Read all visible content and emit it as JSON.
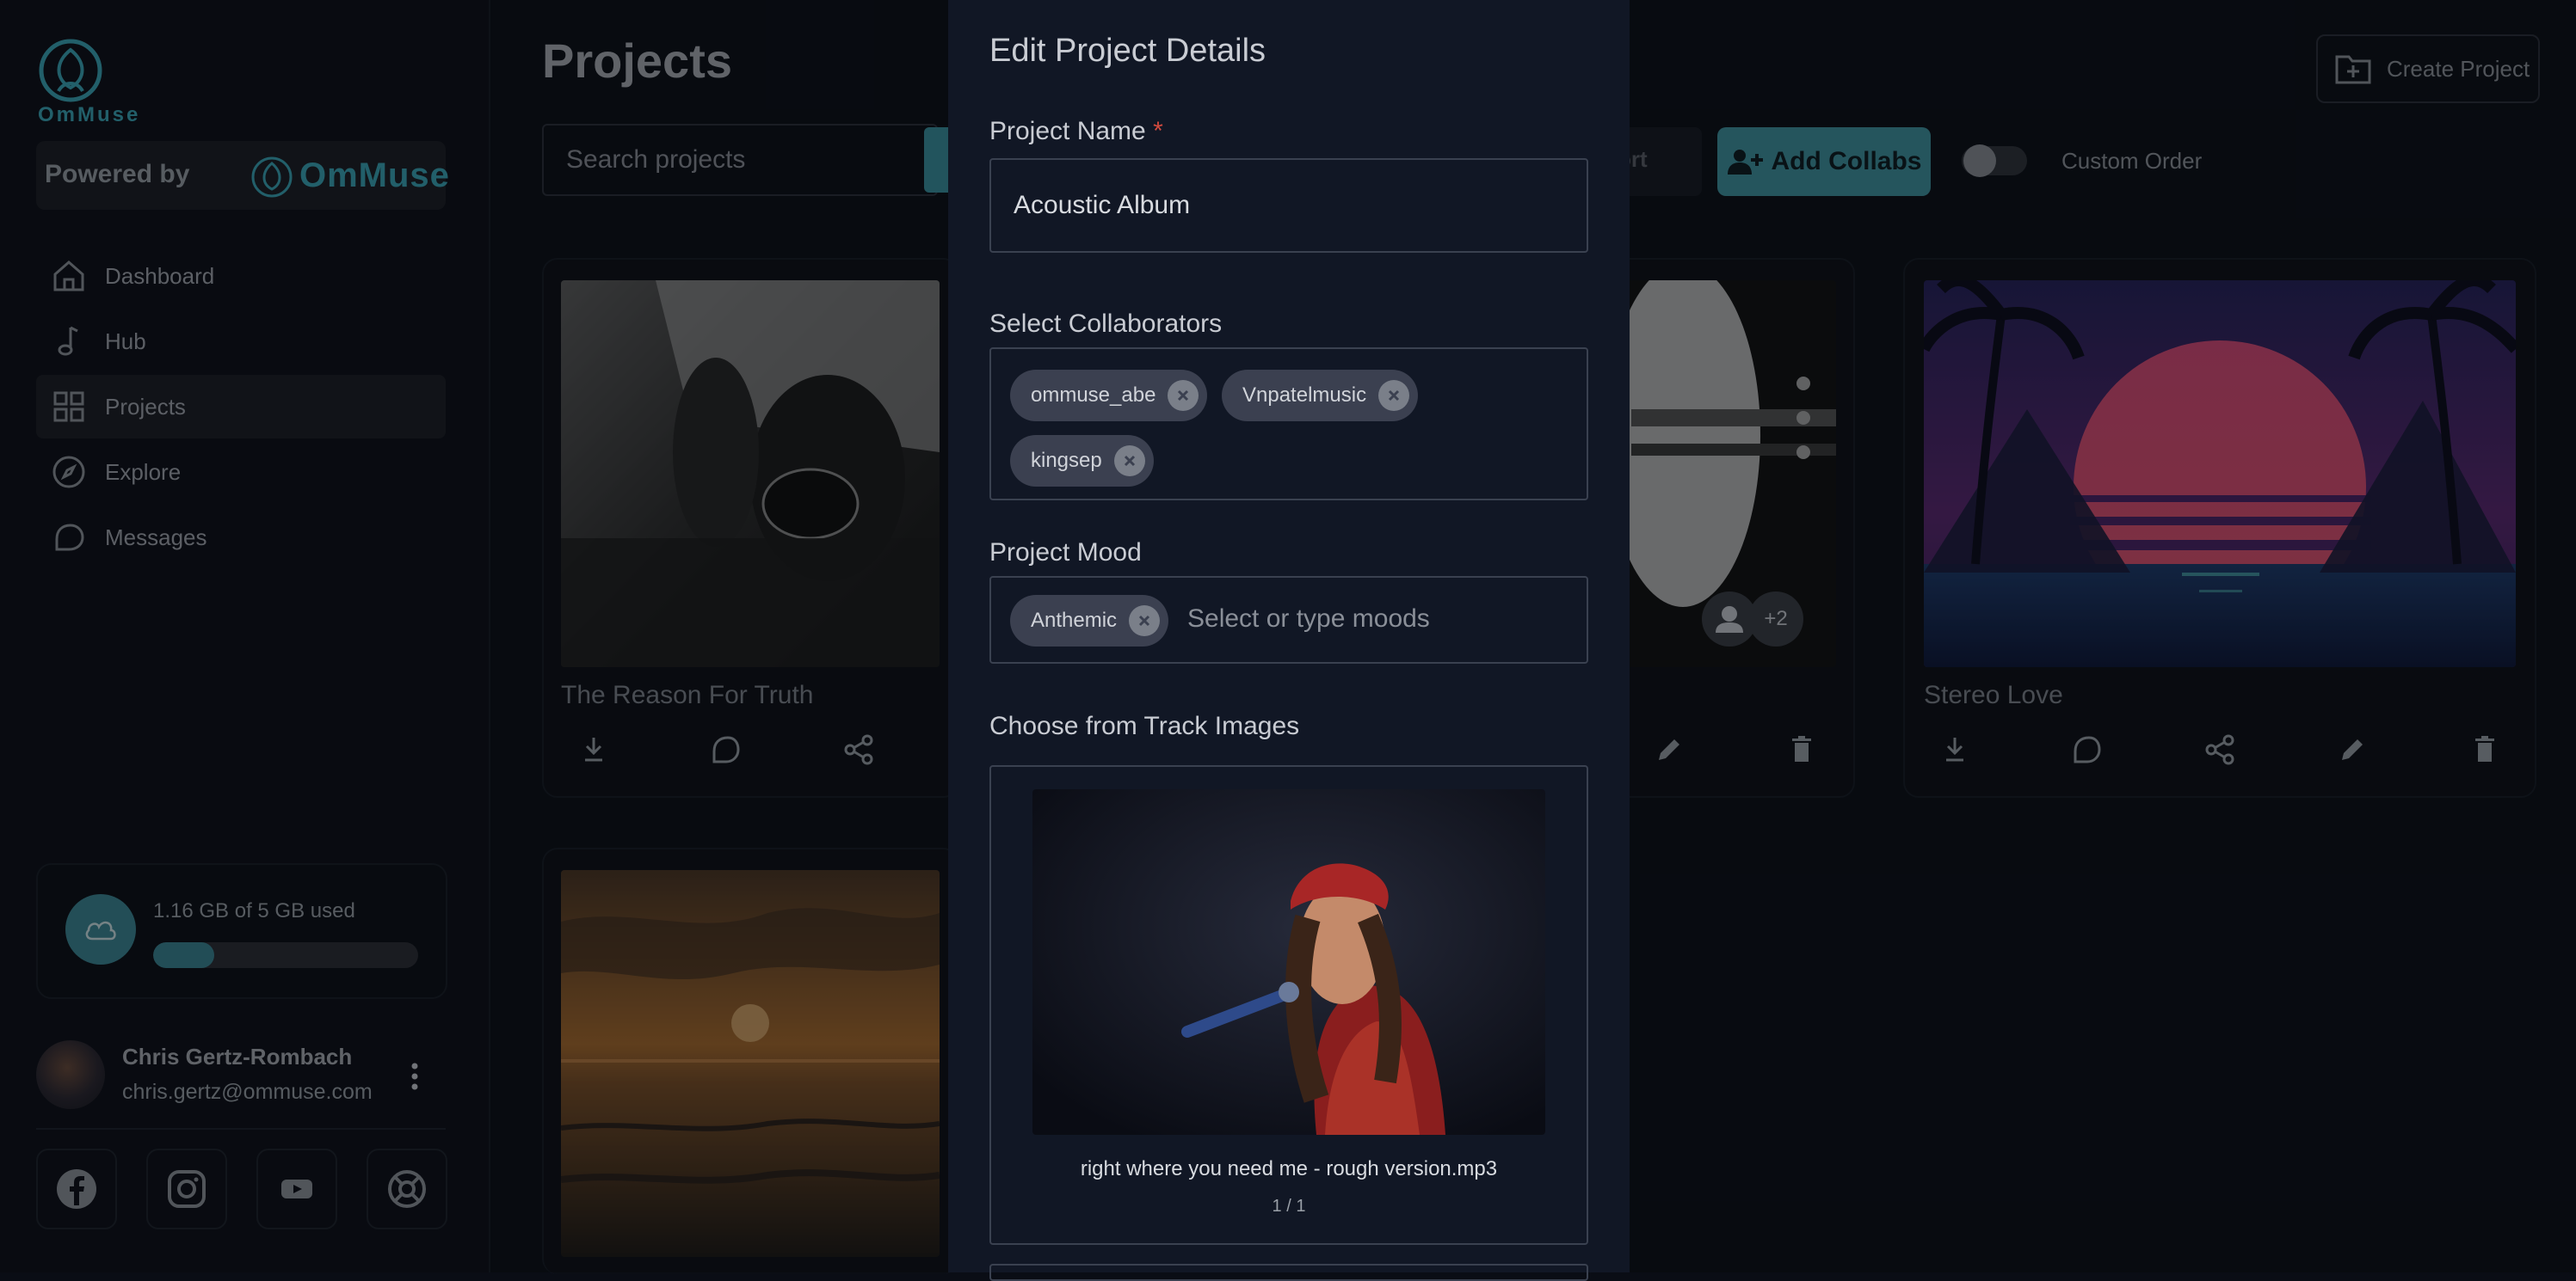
{
  "brand": {
    "name": "OmMuse",
    "powered_by": "Powered by",
    "brand_color": "#3aa7b8"
  },
  "sidebar": {
    "items": [
      {
        "label": "Dashboard",
        "icon": "home-icon"
      },
      {
        "label": "Hub",
        "icon": "music-note-icon"
      },
      {
        "label": "Projects",
        "icon": "grid-icon",
        "active": true
      },
      {
        "label": "Explore",
        "icon": "compass-icon"
      },
      {
        "label": "Messages",
        "icon": "chat-icon"
      }
    ],
    "storage": {
      "text": "1.16 GB of 5 GB used",
      "fraction": 0.232
    },
    "user": {
      "name": "Chris Gertz-Rombach",
      "email": "chris.gertz@ommuse.com"
    },
    "social": [
      "facebook-icon",
      "instagram-icon",
      "youtube-icon",
      "support-icon"
    ]
  },
  "main": {
    "title": "Projects",
    "search_placeholder": "Search projects",
    "sort_label": "ort",
    "add_collabs_label": "Add Collabs",
    "custom_order_label": "Custom Order",
    "create_project_label": "Create Project",
    "cards": [
      {
        "title": "The Reason For Truth"
      },
      {
        "title": "",
        "avatar_more": "+2"
      },
      {
        "title": "Stereo Love"
      },
      {
        "title": ""
      }
    ]
  },
  "modal": {
    "title": "Edit Project Details",
    "project_name_label": "Project Name",
    "required_mark": "*",
    "project_name_value": "Acoustic Album",
    "collaborators_label": "Select Collaborators",
    "collaborators": [
      "ommuse_abe",
      "Vnpatelmusic",
      "kingsep"
    ],
    "mood_label": "Project Mood",
    "moods": [
      "Anthemic"
    ],
    "mood_placeholder": "Select or type moods",
    "track_images_label": "Choose from Track Images",
    "track_name": "right where you need me - rough version.mp3",
    "track_count": "1 / 1"
  }
}
